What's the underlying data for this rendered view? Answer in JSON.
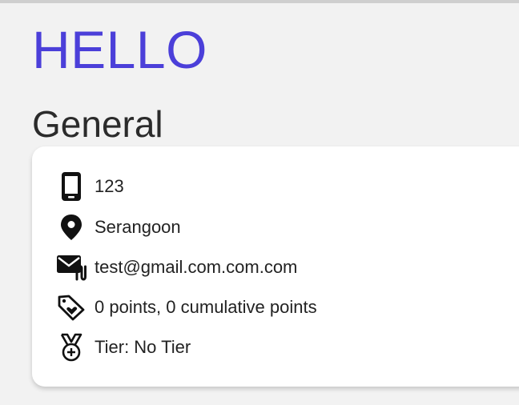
{
  "header": {
    "greeting": "HELLO",
    "section_title": "General"
  },
  "profile": {
    "phone": "123",
    "location": "Serangoon",
    "email": "test@gmail.com.com.com",
    "points": "0 points, 0 cumulative points",
    "tier": "Tier: No Tier"
  },
  "icons": {
    "phone": "mobile-phone-icon",
    "location": "map-pin-icon",
    "email": "mail-attachment-icon",
    "points": "tag-heart-icon",
    "tier": "medal-icon"
  },
  "colors": {
    "accent": "#4b3fd9",
    "background": "#f2f2f2",
    "card": "#ffffff"
  }
}
